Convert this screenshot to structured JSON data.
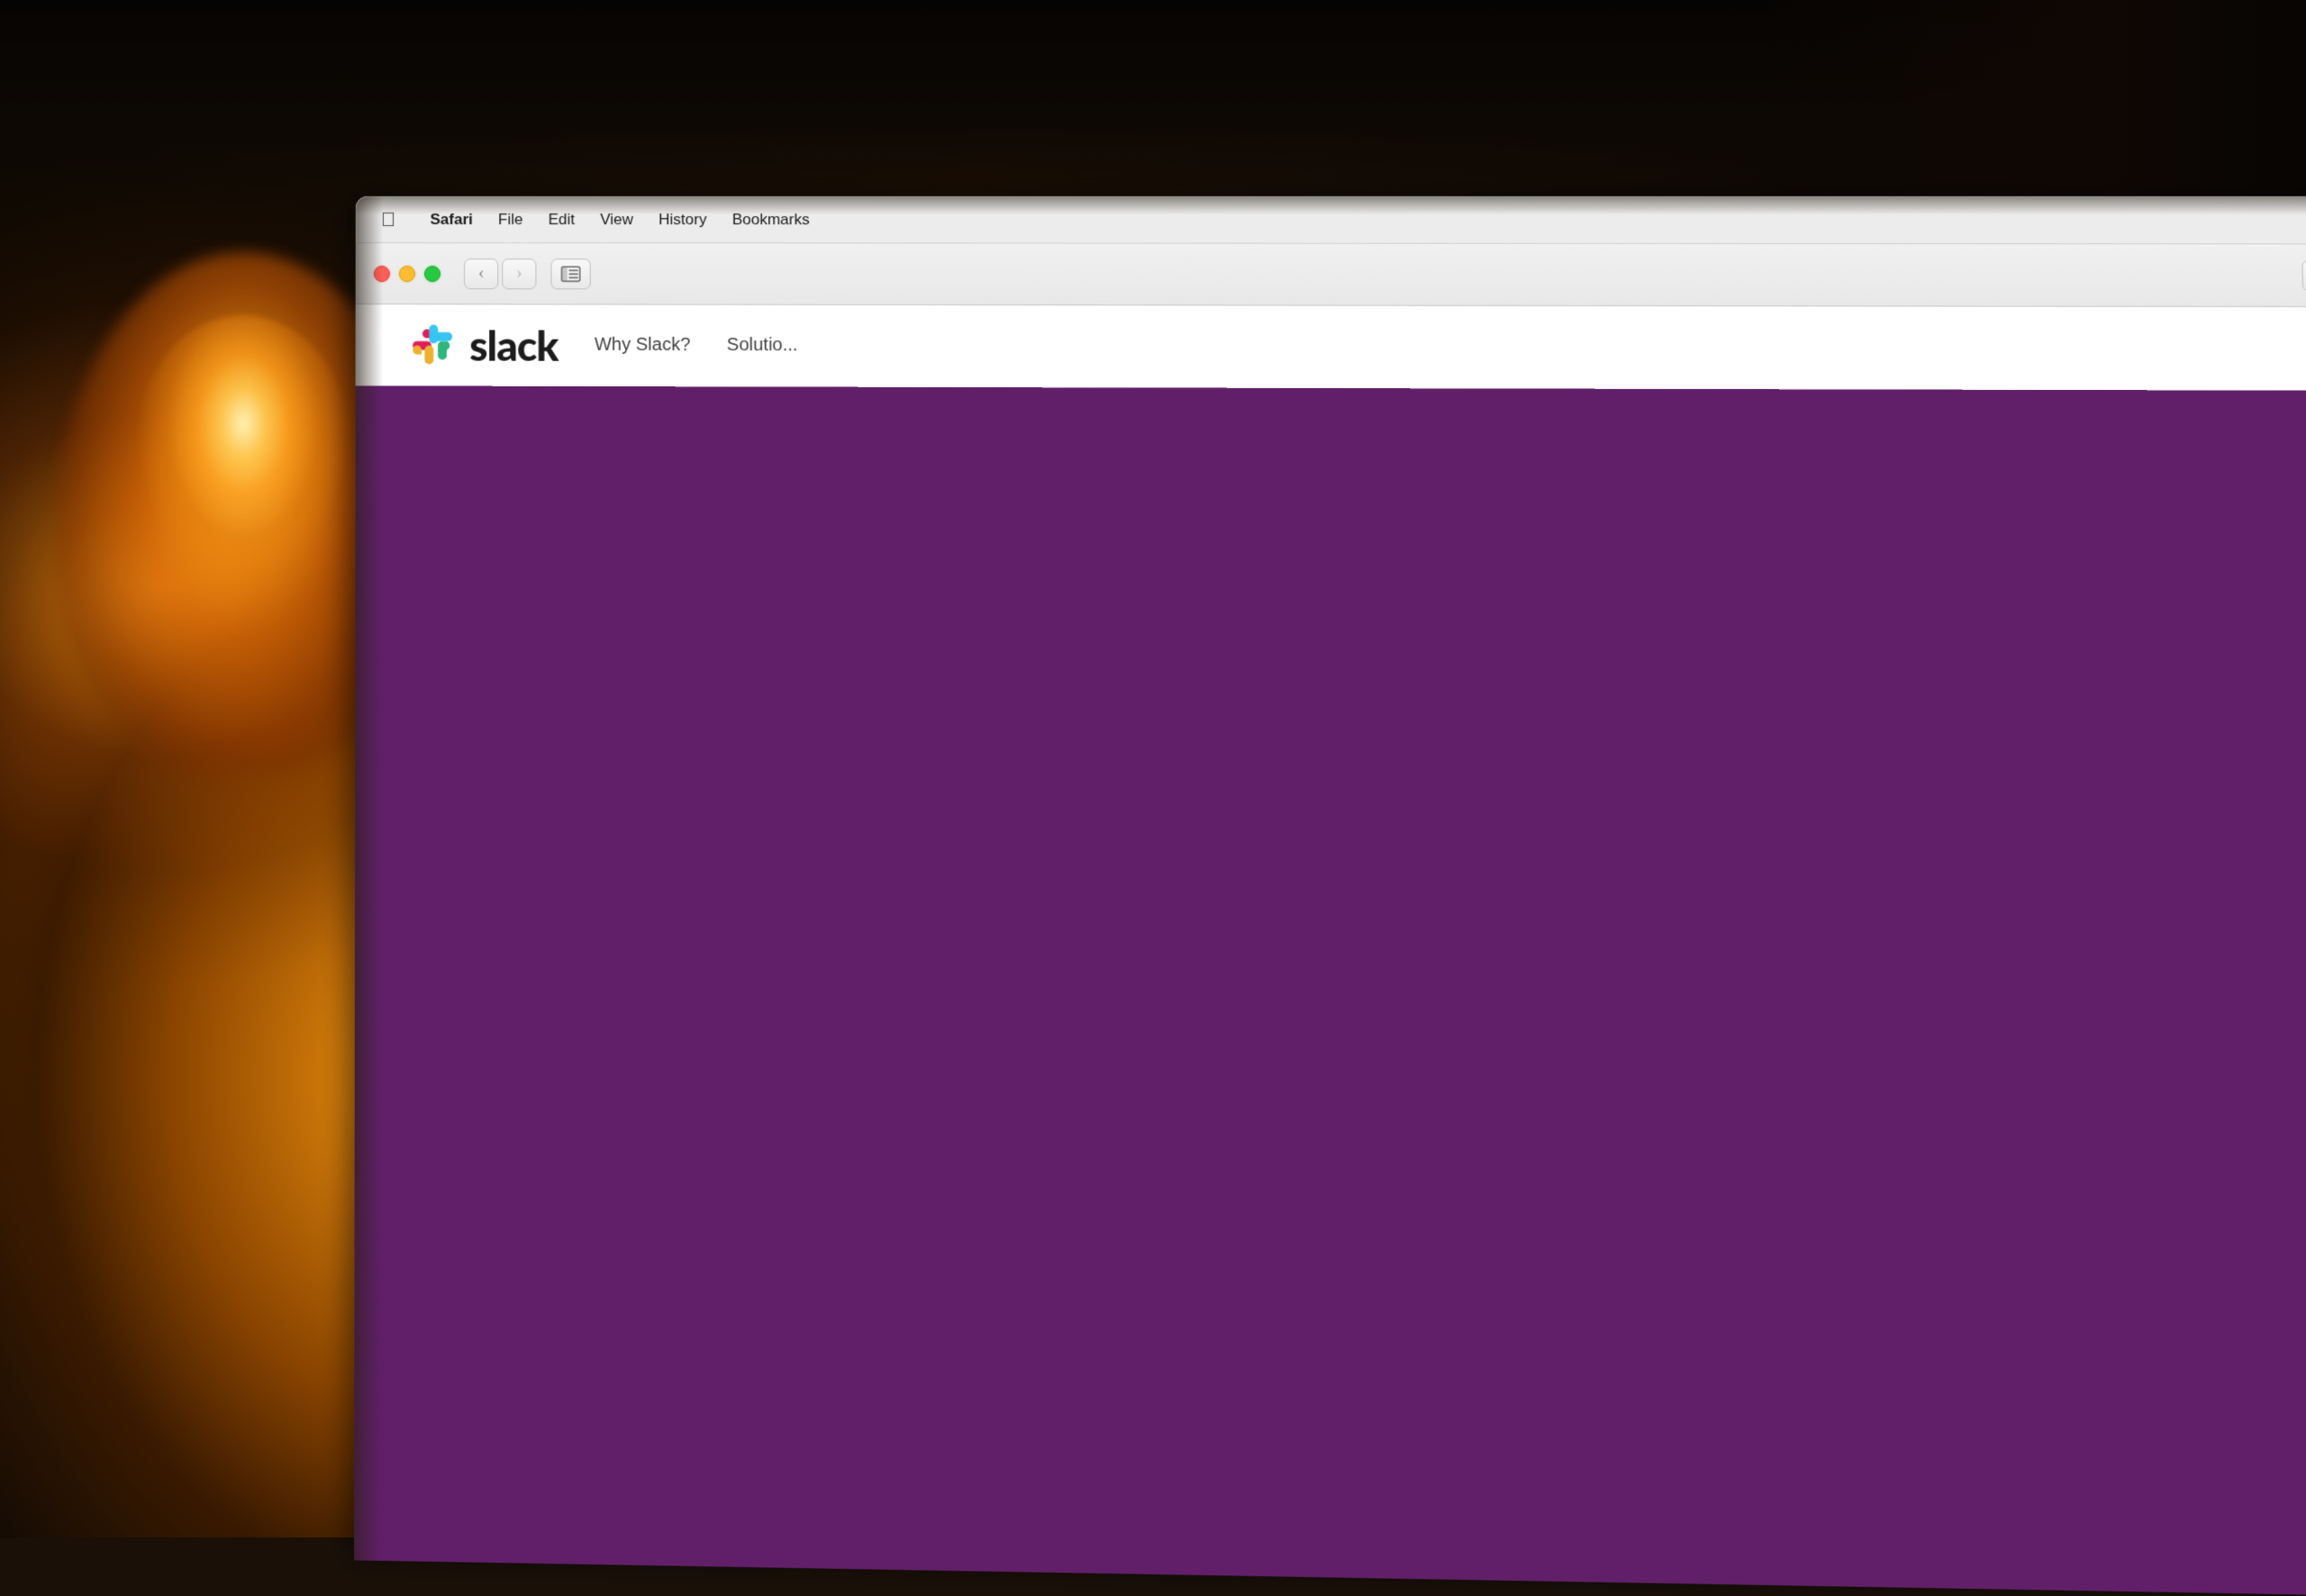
{
  "background": {
    "color": "#1a1008"
  },
  "menubar": {
    "apple_icon": "🍎",
    "items": [
      {
        "label": "Safari",
        "bold": true
      },
      {
        "label": "File"
      },
      {
        "label": "Edit"
      },
      {
        "label": "View"
      },
      {
        "label": "History"
      },
      {
        "label": "Bookmarks"
      }
    ]
  },
  "browser": {
    "back_button": "‹",
    "forward_button": "›",
    "sidebar_icon": "⊡",
    "grid_icon": "⠿"
  },
  "slack_nav": {
    "logo_text": "slack",
    "nav_items": [
      {
        "label": "Why Slack?"
      },
      {
        "label": "Solutio..."
      }
    ]
  },
  "traffic_lights": {
    "red_color": "#ff5f57",
    "yellow_color": "#febc2e",
    "green_color": "#28c840"
  },
  "slack_brand": {
    "purple": "#611f69",
    "hashtag_colors": {
      "top_left": "#e01e5a",
      "top_right": "#36c5f0",
      "bottom_left": "#2eb67d",
      "bottom_right": "#ecb22e"
    }
  }
}
